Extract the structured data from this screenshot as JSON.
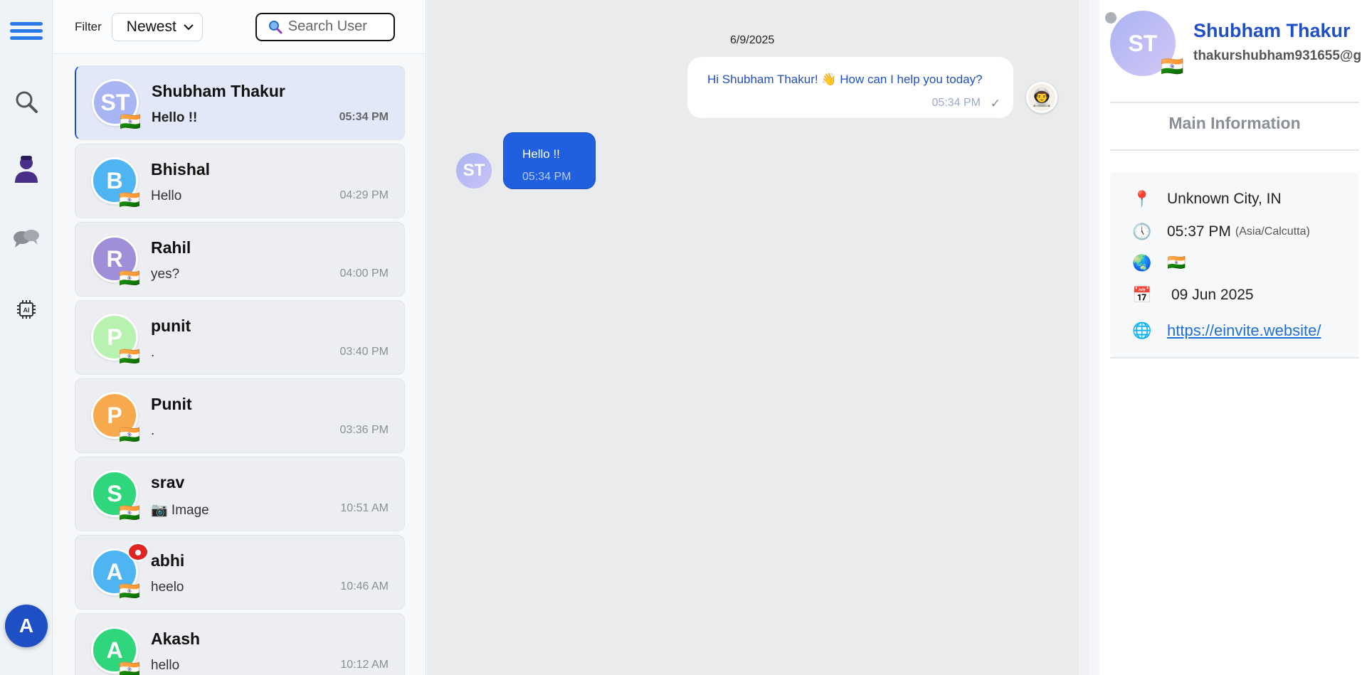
{
  "filter": {
    "label": "Filter",
    "selected": "Newest"
  },
  "search": {
    "placeholder": "Search User"
  },
  "conversations": [
    {
      "initials": "ST",
      "name": "Shubham Thakur",
      "last_message": "Hello !!",
      "time": "05:34 PM",
      "flag": "🇮🇳",
      "color": "#a9b4f2",
      "active": true
    },
    {
      "initials": "B",
      "name": "Bhishal",
      "last_message": "Hello",
      "time": "04:29 PM",
      "flag": "🇮🇳",
      "color": "#4fb4f2"
    },
    {
      "initials": "R",
      "name": "Rahil",
      "last_message": "yes?",
      "time": "04:00 PM",
      "flag": "🇮🇳",
      "color": "#a08ed8"
    },
    {
      "initials": "P",
      "name": "punit",
      "last_message": ".",
      "time": "03:40 PM",
      "flag": "🇮🇳",
      "color": "#b8f2b0"
    },
    {
      "initials": "P",
      "name": "Punit",
      "last_message": ".",
      "time": "03:36 PM",
      "flag": "🇮🇳",
      "color": "#f7a94e"
    },
    {
      "initials": "S",
      "name": "srav",
      "last_message": "📷 Image",
      "time": "10:51 AM",
      "flag": "🇮🇳",
      "color": "#2fd67c"
    },
    {
      "initials": "A",
      "name": "abhi",
      "last_message": "heelo",
      "time": "10:46 AM",
      "flag": "🇮🇳",
      "color": "#4fb4f2",
      "unread": true
    },
    {
      "initials": "A",
      "name": "Akash",
      "last_message": "hello",
      "time": "10:12 AM",
      "flag": "🇮🇳",
      "color": "#2fd67c"
    }
  ],
  "chat": {
    "date": "6/9/2025",
    "outgoing": {
      "text": "Hi Shubham Thakur! 👋 How can I help you today?",
      "time": "05:34 PM",
      "check": "✓"
    },
    "incoming": {
      "initials": "ST",
      "text": "Hello !!",
      "time": "05:34 PM"
    }
  },
  "details": {
    "initials": "ST",
    "flag": "🇮🇳",
    "name": "Shubham Thakur",
    "email": "thakurshubham931655@g",
    "section_title": "Main Information",
    "location": "Unknown City, IN",
    "local_time": "05:37 PM",
    "timezone": "(Asia/Calcutta)",
    "country_flag": "🇮🇳",
    "date": "09 Jun 2025",
    "website": "https://einvite.website/"
  },
  "user": {
    "initial": "A"
  },
  "colors": {
    "accent": "#1f4fc4",
    "bubble_in": "#1f5fe0",
    "link": "#1f6fd6"
  }
}
